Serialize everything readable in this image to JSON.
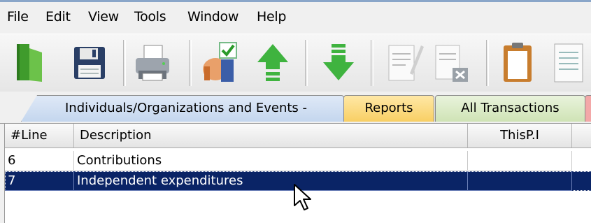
{
  "menu": {
    "file": "File",
    "edit": "Edit",
    "view": "View",
    "tools": "Tools",
    "window": "Window",
    "help": "Help"
  },
  "toolbar": {
    "icons": [
      "open-folder-icon",
      "save-disk-icon",
      "printer-icon",
      "approve-thumb-icon",
      "upload-arrow-icon",
      "download-arrow-icon",
      "edit-document-icon",
      "delete-document-icon",
      "clipboard-icon",
      "document-list-icon"
    ]
  },
  "tabs": {
    "t1": "Individuals/Organizations and Events -",
    "t2": "Reports",
    "t3": "All Transactions"
  },
  "grid": {
    "headers": {
      "line": "#Line",
      "description": "Description",
      "thisp": "ThisP.I"
    },
    "rows": [
      {
        "line": "6",
        "description": "Contributions",
        "thisp": ""
      },
      {
        "line": "7",
        "description": "Independent expenditures",
        "thisp": ""
      }
    ]
  },
  "colors": {
    "selection": "#0a2466",
    "tab_reports": "#f8cf64",
    "tab_transactions": "#cfe3b5",
    "tab_individuals": "#c4d6ee"
  }
}
